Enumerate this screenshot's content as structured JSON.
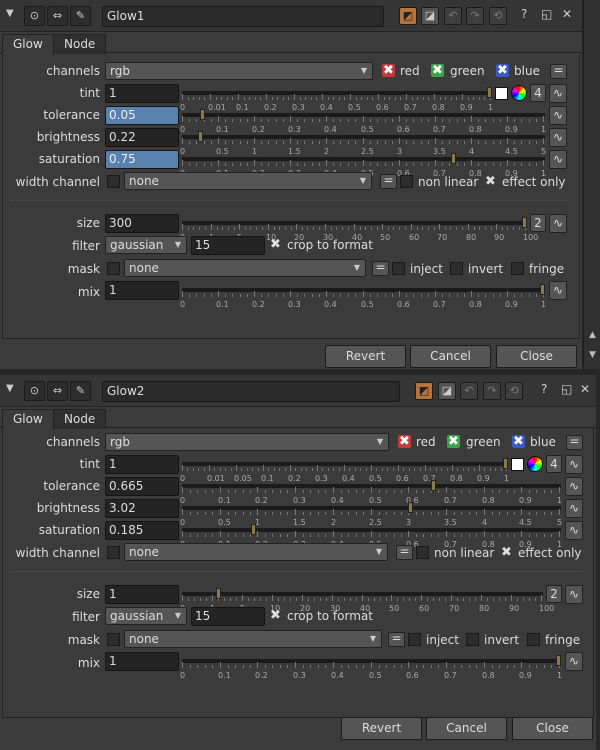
{
  "panels": [
    {
      "id": "p1",
      "node_name": "Glow1",
      "tabs": [
        "Glow",
        "Node"
      ],
      "channels": {
        "label": "channels",
        "value": "rgb",
        "red": "red",
        "green": "green",
        "blue": "blue"
      },
      "tint": {
        "label": "tint",
        "value": "1",
        "count": "4",
        "ticks": [
          "0",
          "0.01",
          "0.1",
          "0.2",
          "0.3",
          "0.4",
          "0.5",
          "0.6",
          "0.7",
          "0.8",
          "0.9",
          "1"
        ]
      },
      "tolerance": {
        "label": "tolerance",
        "value": "0.05",
        "ticks": [
          "0",
          "0.1",
          "0.2",
          "0.3",
          "0.4",
          "0.5",
          "0.6",
          "0.7",
          "0.8",
          "0.9",
          "1"
        ]
      },
      "brightness": {
        "label": "brightness",
        "value": "0.22",
        "ticks": [
          "0",
          "0.5",
          "1",
          "1.5",
          "2",
          "2.5",
          "3",
          "3.5",
          "4",
          "4.5",
          "5"
        ]
      },
      "saturation": {
        "label": "saturation",
        "value": "0.75",
        "ticks": [
          "0",
          "0.1",
          "0.2",
          "0.3",
          "0.4",
          "0.5",
          "0.6",
          "0.7",
          "0.8",
          "0.9",
          "1"
        ]
      },
      "width_channel": {
        "label": "width channel",
        "value": "none",
        "non_linear": "non linear",
        "effect_only": "effect only"
      },
      "size": {
        "label": "size",
        "value": "300",
        "count": "2",
        "ticks": [
          "0",
          "1",
          "5",
          "10",
          "20",
          "30",
          "40",
          "50",
          "60",
          "70",
          "80",
          "90",
          "100"
        ]
      },
      "filter": {
        "label": "filter",
        "value": "gaussian",
        "amount": "15",
        "crop": "crop to format"
      },
      "mask": {
        "label": "mask",
        "value": "none",
        "inject": "inject",
        "invert": "invert",
        "fringe": "fringe"
      },
      "mix": {
        "label": "mix",
        "value": "1",
        "ticks": [
          "0",
          "0.1",
          "0.2",
          "0.3",
          "0.4",
          "0.5",
          "0.6",
          "0.7",
          "0.8",
          "0.9",
          "1"
        ]
      },
      "buttons": {
        "revert": "Revert",
        "cancel": "Cancel",
        "close": "Close"
      }
    },
    {
      "id": "p2",
      "node_name": "Glow2",
      "tabs": [
        "Glow",
        "Node"
      ],
      "channels": {
        "label": "channels",
        "value": "rgb",
        "red": "red",
        "green": "green",
        "blue": "blue"
      },
      "tint": {
        "label": "tint",
        "value": "1",
        "count": "4",
        "ticks": [
          "0",
          "0.01",
          "0.05",
          "0.1",
          "0.2",
          "0.3",
          "0.4",
          "0.5",
          "0.6",
          "0.7",
          "0.8",
          "0.9",
          "1"
        ]
      },
      "tolerance": {
        "label": "tolerance",
        "value": "0.665",
        "ticks": [
          "0",
          "0.1",
          "0.2",
          "0.3",
          "0.4",
          "0.5",
          "0.6",
          "0.7",
          "0.8",
          "0.9",
          "1"
        ]
      },
      "brightness": {
        "label": "brightness",
        "value": "3.02",
        "ticks": [
          "0",
          "0.5",
          "1",
          "1.5",
          "2",
          "2.5",
          "3",
          "3.5",
          "4",
          "4.5",
          "5"
        ]
      },
      "saturation": {
        "label": "saturation",
        "value": "0.185",
        "ticks": [
          "0",
          "0.1",
          "0.2",
          "0.3",
          "0.4",
          "0.5",
          "0.6",
          "0.7",
          "0.8",
          "0.9",
          "1"
        ]
      },
      "width_channel": {
        "label": "width channel",
        "value": "none",
        "non_linear": "non linear",
        "effect_only": "effect only"
      },
      "size": {
        "label": "size",
        "value": "1",
        "count": "2",
        "ticks": [
          "0",
          "1",
          "5",
          "10",
          "20",
          "30",
          "40",
          "50",
          "60",
          "70",
          "80",
          "90",
          "100"
        ]
      },
      "filter": {
        "label": "filter",
        "value": "gaussian",
        "amount": "15",
        "crop": "crop to format"
      },
      "mask": {
        "label": "mask",
        "value": "none",
        "inject": "inject",
        "invert": "invert",
        "fringe": "fringe"
      },
      "mix": {
        "label": "mix",
        "value": "1",
        "ticks": [
          "0",
          "0.1",
          "0.2",
          "0.3",
          "0.4",
          "0.5",
          "0.6",
          "0.7",
          "0.8",
          "0.9",
          "1"
        ]
      },
      "buttons": {
        "revert": "Revert",
        "cancel": "Cancel",
        "close": "Close"
      }
    }
  ],
  "colors": {
    "selected_field": "#5881b0",
    "accent_orange": "#b8733a",
    "red": "#c23b3b",
    "green": "#3aa44b",
    "blue": "#3a58c2"
  }
}
